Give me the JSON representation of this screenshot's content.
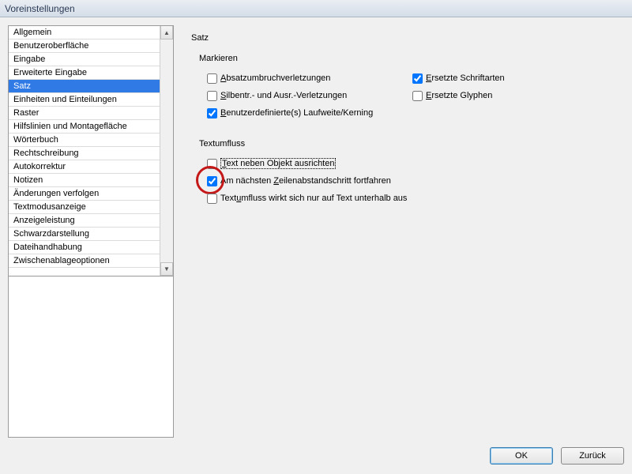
{
  "window": {
    "title": "Voreinstellungen"
  },
  "sidebar": {
    "items": [
      "Allgemein",
      "Benutzeroberfläche",
      "Eingabe",
      "Erweiterte Eingabe",
      "Satz",
      "Einheiten und Einteilungen",
      "Raster",
      "Hilfslinien und Montagefläche",
      "Wörterbuch",
      "Rechtschreibung",
      "Autokorrektur",
      "Notizen",
      "Änderungen verfolgen",
      "Textmodusanzeige",
      "Anzeigeleistung",
      "Schwarzdarstellung",
      "Dateihandhabung",
      "Zwischenablageoptionen"
    ],
    "selected_index": 4
  },
  "panel": {
    "title": "Satz",
    "groups": {
      "markieren": {
        "label": "Markieren",
        "opts": {
          "absatz": {
            "label": "Absatzumbruchverletzungen",
            "underline": "A",
            "checked": false
          },
          "ersetzte_schrift": {
            "label": "Ersetzte Schriftarten",
            "underline": "E",
            "checked": true
          },
          "silbentr": {
            "label": "Silbentr.- und Ausr.-Verletzungen",
            "underline": "S",
            "checked": false
          },
          "ersetzte_glyphen": {
            "label": "Ersetzte Glyphen",
            "underline": "E",
            "checked": false
          },
          "benutzer_kerning": {
            "label": "Benutzerdefinierte(s) Laufweite/Kerning",
            "underline": "B",
            "checked": true
          }
        }
      },
      "textumfluss": {
        "label": "Textumfluss",
        "opts": {
          "neben_objekt": {
            "label": "Text neben Objekt ausrichten",
            "underline": "T",
            "checked": false
          },
          "naechster_zeilen": {
            "label": "Am nächsten Zeilenabstandschritt fortfahren",
            "underline": "Z",
            "checked": true
          },
          "unterhalb": {
            "label": "Textumfluss wirkt sich nur auf Text unterhalb aus",
            "underline": "u",
            "checked": false
          }
        }
      }
    }
  },
  "buttons": {
    "ok": "OK",
    "back": "Zurück"
  }
}
